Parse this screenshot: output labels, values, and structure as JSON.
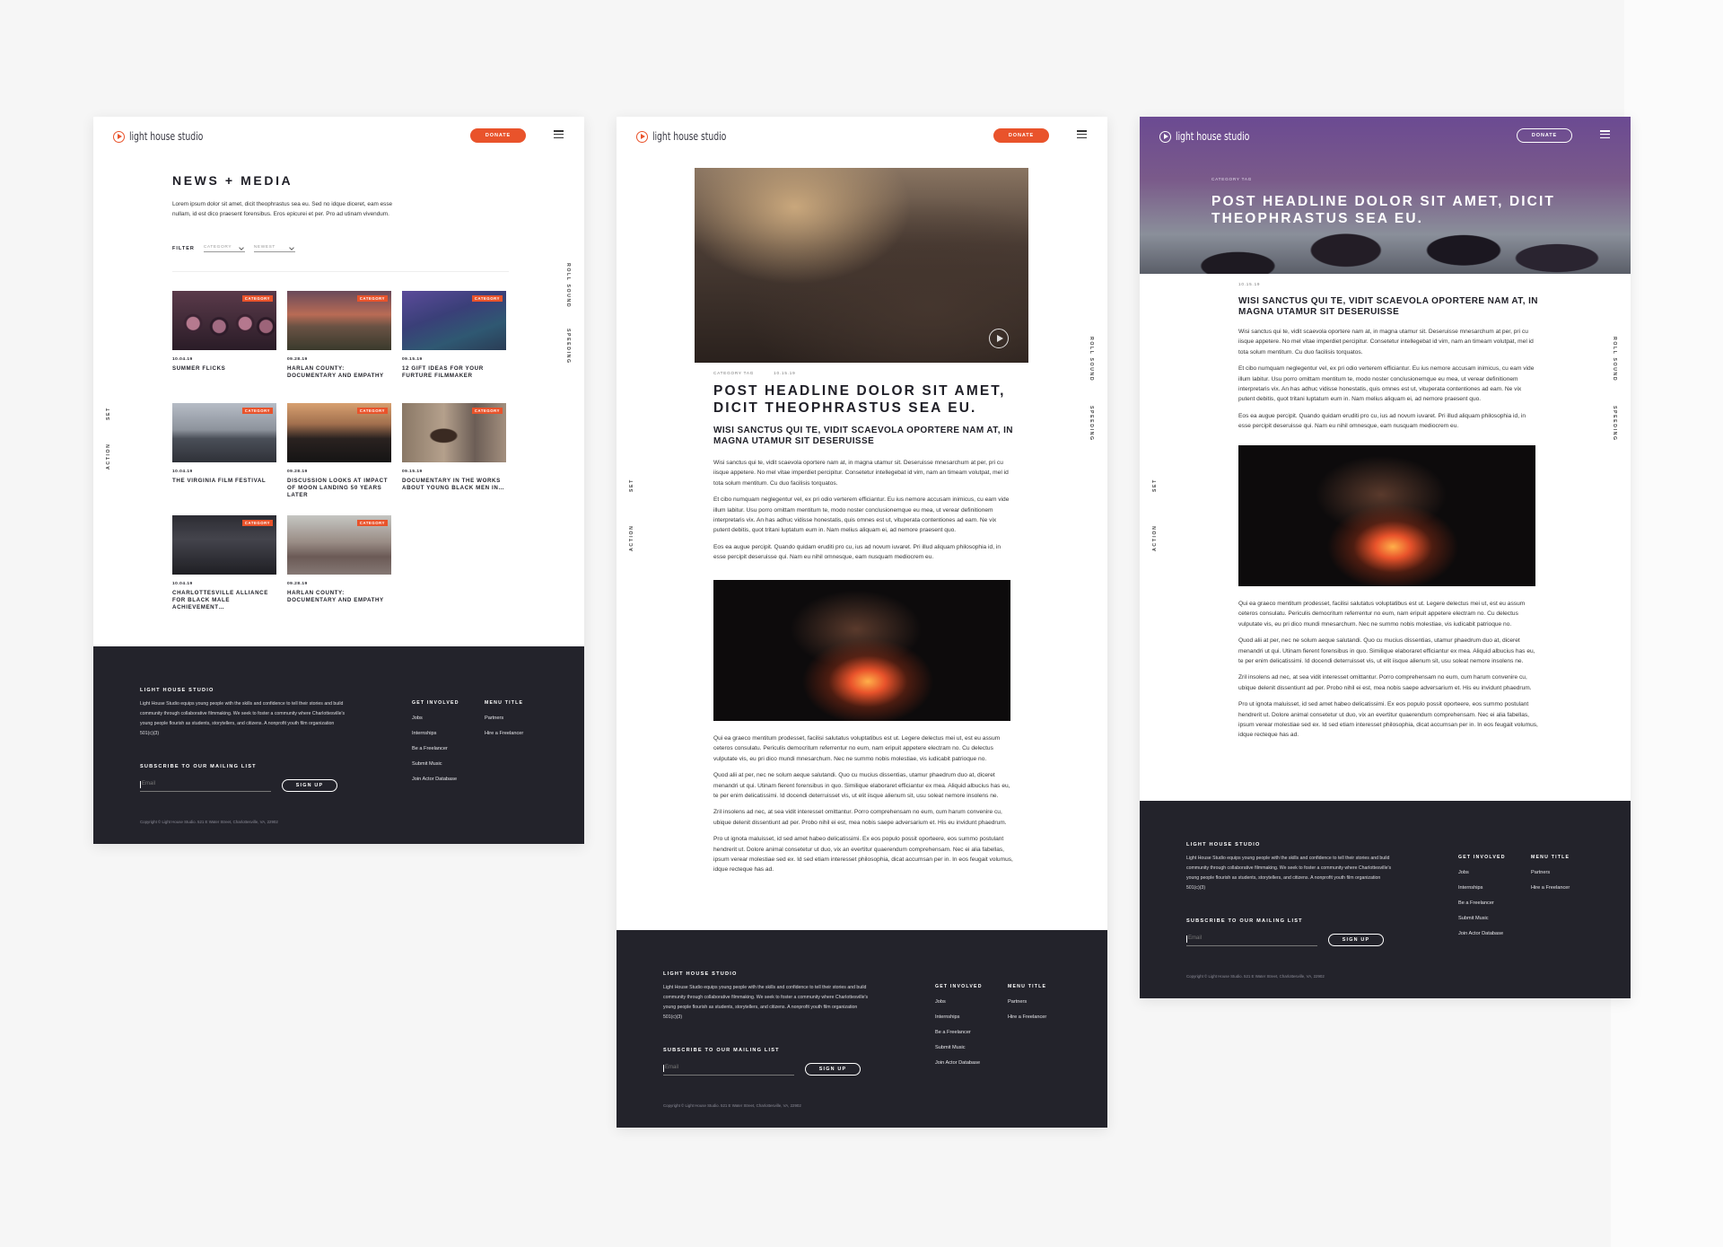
{
  "brand": {
    "logo_text": "light house studio",
    "donate_label": "DONATE",
    "accent": "#e9532b",
    "dark": "#23232b"
  },
  "side_words": {
    "roll_sound": "ROLL SOUND",
    "speeding": "SPEEDING",
    "set": "SET",
    "action": "ACTION"
  },
  "news": {
    "title": "NEWS + MEDIA",
    "intro": "Lorem ipsum dolor sit amet, dicit theophrastus sea eu. Sed no idque diceret, eam esse nullam, id est dico praesent forensibus. Eros epicurei et per. Pro ad utinam vivendum.",
    "filter_label": "FILTER",
    "category_select": "CATEGORY",
    "sort_select": "NEWEST",
    "cards": [
      {
        "tag": "CATEGORY",
        "date": "10.04.19",
        "title": "SUMMER FLICKS"
      },
      {
        "tag": "CATEGORY",
        "date": "09.28.19",
        "title": "HARLAN COUNTY: DOCUMENTARY AND EMPATHY"
      },
      {
        "tag": "CATEGORY",
        "date": "09.15.19",
        "title": "12 GIFT IDEAS FOR YOUR FURTURE FILMMAKER"
      },
      {
        "tag": "CATEGORY",
        "date": "10.04.19",
        "title": "THE VIRGINIA FILM FESTIVAL"
      },
      {
        "tag": "CATEGORY",
        "date": "09.28.19",
        "title": "DISCUSSION LOOKS AT IMPACT OF MOON LANDING 50 YEARS LATER"
      },
      {
        "tag": "CATEGORY",
        "date": "09.15.19",
        "title": "DOCUMENTARY IN THE WORKS ABOUT YOUNG BLACK MEN IN…"
      },
      {
        "tag": "CATEGORY",
        "date": "10.04.19",
        "title": "CHARLOTTESVILLE ALLIANCE FOR BLACK MALE ACHIEVEMENT…"
      },
      {
        "tag": "CATEGORY",
        "date": "09.28.19",
        "title": "HARLAN COUNTY: DOCUMENTARY AND EMPATHY"
      }
    ]
  },
  "article": {
    "category_tag": "CATEGORY TAG",
    "date": "10.15.19",
    "headline": "POST HEADLINE DOLOR SIT AMET, DICIT THEOPHRASTUS SEA EU.",
    "subhead": "WISI SANCTUS QUI TE, VIDIT SCAEVOLA OPORTERE NAM AT, IN MAGNA UTAMUR SIT DESERUISSE",
    "para1": "Wisi sanctus qui te, vidit scaevola oportere nam at, in magna utamur sit. Deseruisse mnesarchum at per, pri cu iisque appetere. No mel vitae imperdiet percipitur. Consetetur intellegebat id vim, nam an timeam volutpat, mel id tota solum mentitum. Cu duo facilisis torquatos.",
    "para2": "Et cibo numquam neglegentur vel, ex pri odio verterem efficiantur. Eu ius nemore accusam inimicus, cu eam vide illum labitur. Usu porro omittam mentitum te, modo noster conclusionemque eu mea, ut verear definitionem interpretaris vix. An has adhuc vidisse honestatis, quis omnes est ut, vituperata contentiones ad eam. Ne vix putent debitis, quot tritani luptatum eum in. Nam melius aliquam ei, ad nemore praesent quo.",
    "para3": "Eos ea augue percipit. Quando quidam eruditi pro cu, ius ad novum iuvaret. Pri illud aliquam philosophia id, in esse percipit deseruisse qui. Nam eu nihil omnesque, eam nusquam mediocrem eu.",
    "para4": "Qui ea graeco mentitum prodesset, facilisi salutatus voluptatibus est ut. Legere delectus mei ut, est eu assum ceteros consulatu. Periculis democritum referrentur no eum, nam eripuit appetere electram no. Cu delectus vulputate vis, eu pri dico mundi mnesarchum. Nec ne summo nobis molestiae, vis iudicabit patrioque no.",
    "para5": "Quod alii at per, nec ne solum aeque salutandi. Quo cu mucius dissentias, utamur phaedrum duo at, diceret menandri ut qui. Utinam fierent forensibus in quo. Similique elaboraret efficiantur ex mea. Aliquid albucius has eu, te per enim delicatissimi. Id docendi deterruisset vis, ut elit iisque alienum sit, usu soleat nemore insolens ne.",
    "para6": "Zril insolens ad nec, at sea vidit interesset omittantur. Porro comprehensam no eum, cum harum convenire cu, ubique delenit dissentiunt ad per. Probo nihil ei est, mea nobis saepe adversarium et. His eu invidunt phaedrum.",
    "para7": "Pro ut ignota maluisset, id sed amet habeo delicatissimi. Ex eos populo possit oporteere, eos summo postulant hendrerit ut. Dolore animal consetetur ut duo, vix an evertitur quaerendum comprehensam. Nec ei alia fabellas, ipsum verear molestiae sed ex. Id sed etiam interesset philosophia, dicat accumsan per in. In eos feugait volumus, idque recteque has ad."
  },
  "footer": {
    "heading": "LIGHT HOUSE STUDIO",
    "description": "Light House Studio equips young people with the skills and confidence to tell their stories and build community through collaborative filmmaking. We seek to foster a community where Charlottesville's young people flourish as students, storytellers, and citizens. A nonprofit youth film organization 501(c)(3)",
    "subscribe_label": "SUBSCRIBE TO OUR MAILING LIST",
    "email_placeholder": "Email",
    "signup_label": "SIGN UP",
    "col1_heading": "GET INVOLVED",
    "col1_links": [
      "Jobs",
      "Internships",
      "Be a Freelancer",
      "Submit Music",
      "Join Actor Database"
    ],
    "col2_heading": "MENU TITLE",
    "col2_links": [
      "Partners",
      "Hire a Freelancer"
    ],
    "copyright": "Copyright © Light House Studio. 521 E Water Street, Charlottesville, VA, 22902"
  }
}
